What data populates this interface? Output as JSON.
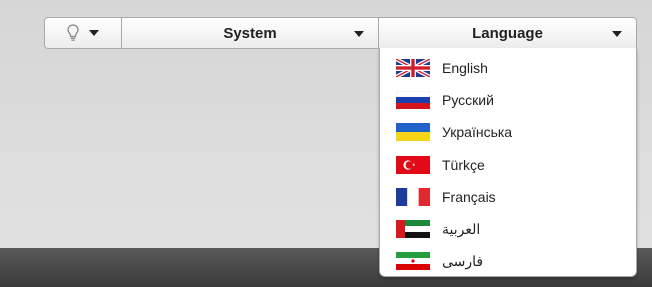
{
  "toolbar": {
    "hint_icon": "lightbulb-icon",
    "system_label": "System",
    "language_label": "Language"
  },
  "languages": [
    {
      "label": "English",
      "flag": "uk-flag-icon"
    },
    {
      "label": "Русский",
      "flag": "russia-flag-icon"
    },
    {
      "label": "Українська",
      "flag": "ukraine-flag-icon"
    },
    {
      "label": "Türkçe",
      "flag": "turkey-flag-icon"
    },
    {
      "label": "Français",
      "flag": "france-flag-icon"
    },
    {
      "label": "العربية",
      "flag": "uae-flag-icon"
    },
    {
      "label": "فارسی",
      "flag": "iran-flag-icon"
    }
  ],
  "colors": {
    "footer_bar": "#454545",
    "dropdown_bg": "#ffffff",
    "border": "#a9a9a9"
  }
}
